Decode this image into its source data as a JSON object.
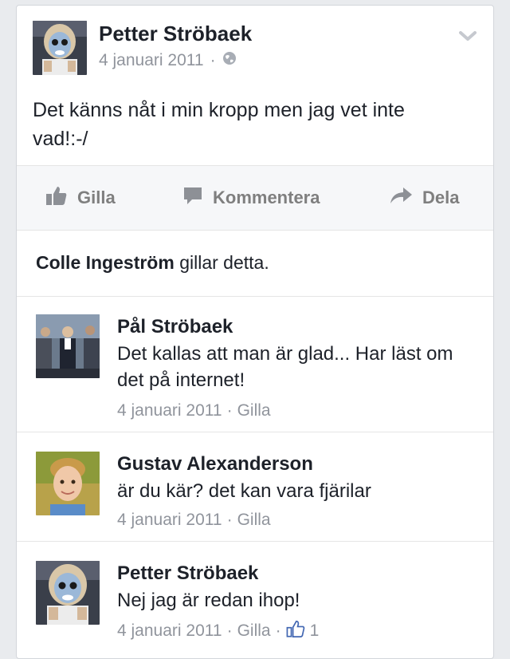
{
  "post": {
    "author": "Petter Ströbaek",
    "date": "4 januari 2011",
    "separator": "·",
    "privacy_icon": "globe-icon",
    "text_line1": "Det känns nåt i min kropp men jag vet inte",
    "text_line2": "vad!:-/"
  },
  "actions": {
    "like_label": "Gilla",
    "comment_label": "Kommentera",
    "share_label": "Dela"
  },
  "likes": {
    "name": "Colle Ingeström",
    "suffix": " gillar detta."
  },
  "comments": [
    {
      "name": "Pål Ströbaek",
      "text": "Det kallas att man är glad... Har läst om det på internet!",
      "date": "4 januari 2011",
      "like": "Gilla"
    },
    {
      "name": "Gustav Alexanderson",
      "text": "är du kär? det kan vara fjärilar",
      "date": "4 januari 2011",
      "like": "Gilla"
    },
    {
      "name": "Petter Ströbaek",
      "text": "Nej jag är redan ihop!",
      "date": "4 januari 2011",
      "like": "Gilla",
      "like_count": "1"
    }
  ],
  "colors": {
    "background": "#e9ebee",
    "card": "#ffffff",
    "meta_gray": "#90949c",
    "action_gray": "#7f7f7f",
    "like_blue": "#4267b2"
  }
}
